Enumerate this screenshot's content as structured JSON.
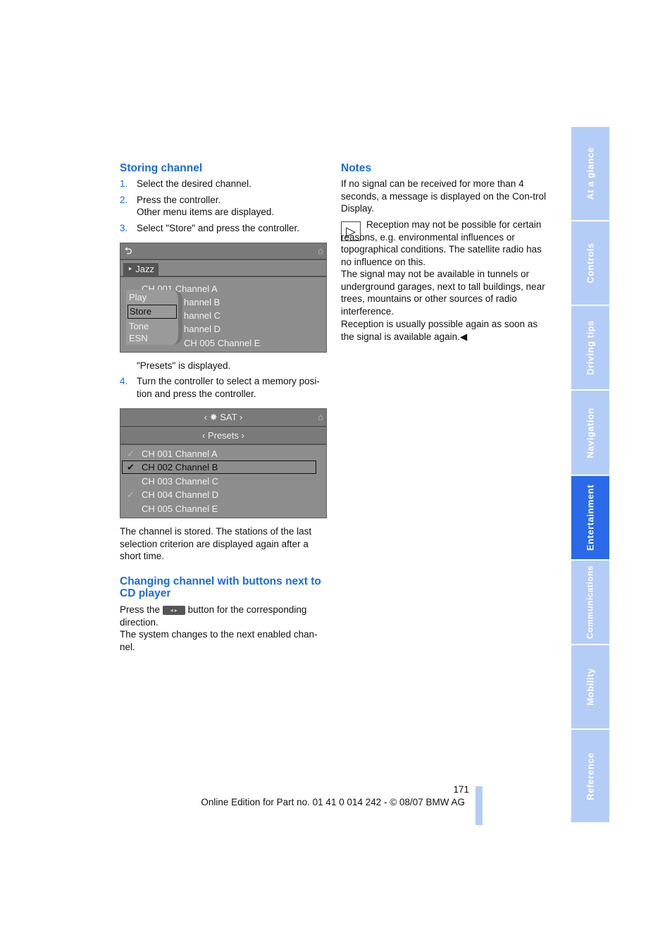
{
  "left": {
    "storing": {
      "title": "Storing channel",
      "steps": [
        {
          "n": "1.",
          "text": "Select the desired channel."
        },
        {
          "n": "2.",
          "text": "Press the controller.",
          "sub": "Other menu items are displayed."
        },
        {
          "n": "3.",
          "text": "Select \"Store\" and press the controller."
        }
      ]
    },
    "screen1": {
      "header": "Jazz",
      "menu": [
        "Play",
        "Store",
        "Tone",
        "ESN"
      ],
      "channels": [
        "CH 001 Channel A",
        "hannel B",
        "hannel C",
        "hannel D",
        "CH 005 Channel E"
      ]
    },
    "presets_text": "\"Presets\" is displayed.",
    "step4": {
      "n": "4.",
      "text": "Turn the controller to select a memory posi-\ntion and press the controller."
    },
    "screen2": {
      "source": "SAT",
      "sub": "Presets",
      "channels": [
        "CH 001 Channel A",
        "CH 002 Channel B",
        "CH 003 Channel C",
        "CH 004 Channel D",
        "CH 005 Channel E"
      ]
    },
    "stored_text": "The channel is stored. The stations of the last selection criterion are displayed again after a short time.",
    "changing": {
      "title": "Changing channel with buttons next to CD player",
      "press_before": "Press the",
      "press_after": "button for the corresponding direction.",
      "text2": "The system changes to the next enabled chan-nel."
    }
  },
  "notes": {
    "title": "Notes",
    "p1": "If no signal can be received for more than 4 seconds, a message is displayed on the Con-trol Display.",
    "p2": "Reception may not be possible for certain reasons, e.g. environmental influences or topographical conditions. The satellite radio has no influence on this.",
    "p3": "The signal may not be available in tunnels or underground garages, next to tall buildings, near trees, mountains or other sources of radio interference.",
    "p4": "Reception is usually possible again as soon as the signal is available again."
  },
  "footer": {
    "page": "171",
    "edition": "Online Edition for Part no. 01 41 0 014 242 - © 08/07 BMW AG"
  },
  "tabs": [
    "At a glance",
    "Controls",
    "Driving tips",
    "Navigation",
    "Entertainment",
    "Communications",
    "Mobility",
    "Reference"
  ],
  "colors": {
    "accent": "#1a6be0",
    "tab": "#b4cdf6",
    "tab_active": "#2a6ae8"
  }
}
